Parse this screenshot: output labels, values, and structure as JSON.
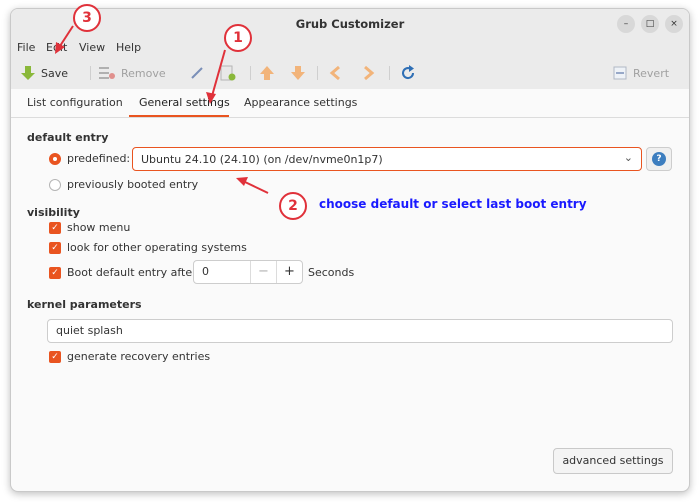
{
  "window": {
    "title": "Grub Customizer",
    "controls": [
      "–",
      "□",
      "×"
    ]
  },
  "menu": [
    "File",
    "Edit",
    "View",
    "Help"
  ],
  "toolbar": {
    "save_label": "Save",
    "remove_label": "Remove",
    "revert_label": "Revert"
  },
  "tabs": {
    "list": "List configuration",
    "general": "General settings",
    "appearance": "Appearance settings"
  },
  "default_entry": {
    "heading": "default entry",
    "predefined_label": "predefined:",
    "selected_value": "Ubuntu 24.10 (24.10) (on /dev/nvme0n1p7)",
    "previously_booted_label": "previously booted entry",
    "help_glyph": "?"
  },
  "visibility": {
    "heading": "visibility",
    "show_menu": "show menu",
    "look_for_os": "look for other operating systems",
    "boot_default_after": "Boot default entry after",
    "timeout_value": "0",
    "minus": "−",
    "plus": "+",
    "seconds": "Seconds"
  },
  "kernel": {
    "heading": "kernel parameters",
    "value": "quiet splash",
    "recovery": "generate recovery entries"
  },
  "advanced_button": "advanced settings",
  "annotations": {
    "badge1": "1",
    "badge2": "2",
    "badge3": "3",
    "note": "choose default or select last boot entry"
  },
  "colors": {
    "accent": "#e95420",
    "annotation_red": "#e0313a",
    "annotation_blue": "#1a1aff"
  }
}
